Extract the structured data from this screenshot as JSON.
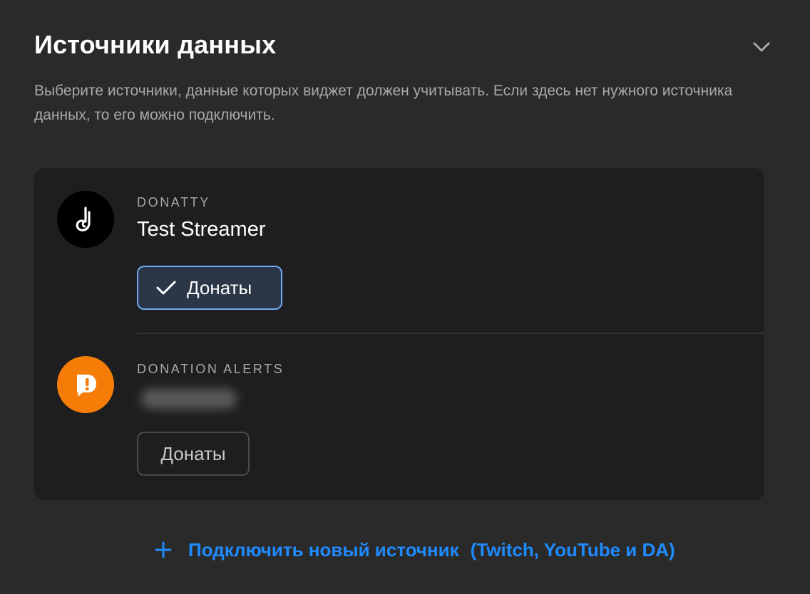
{
  "section": {
    "title": "Источники данных",
    "description": "Выберите источники, данные которых виджет должен учитывать. Если здесь нет нужного источника данных, то его можно подключить."
  },
  "sources": [
    {
      "platform": "DONATTY",
      "account_name": "Test Streamer",
      "icon": "donatty-logo-icon",
      "chip_label": "Донаты",
      "chip_selected": true,
      "accent_color": "#000000"
    },
    {
      "platform": "DONATION ALERTS",
      "account_name": "",
      "icon": "donationalerts-logo-icon",
      "chip_label": "Донаты",
      "chip_selected": false,
      "accent_color": "#f57d07"
    }
  ],
  "add_source": {
    "label": "Подключить новый источник",
    "hint": "(Twitch, YouTube и DA)",
    "color": "#1f8bff"
  },
  "colors": {
    "background": "#2a2a2b",
    "card": "#1e1e20",
    "selected_chip_border": "#6eaaf2",
    "selected_chip_fill": "#2b3747"
  }
}
